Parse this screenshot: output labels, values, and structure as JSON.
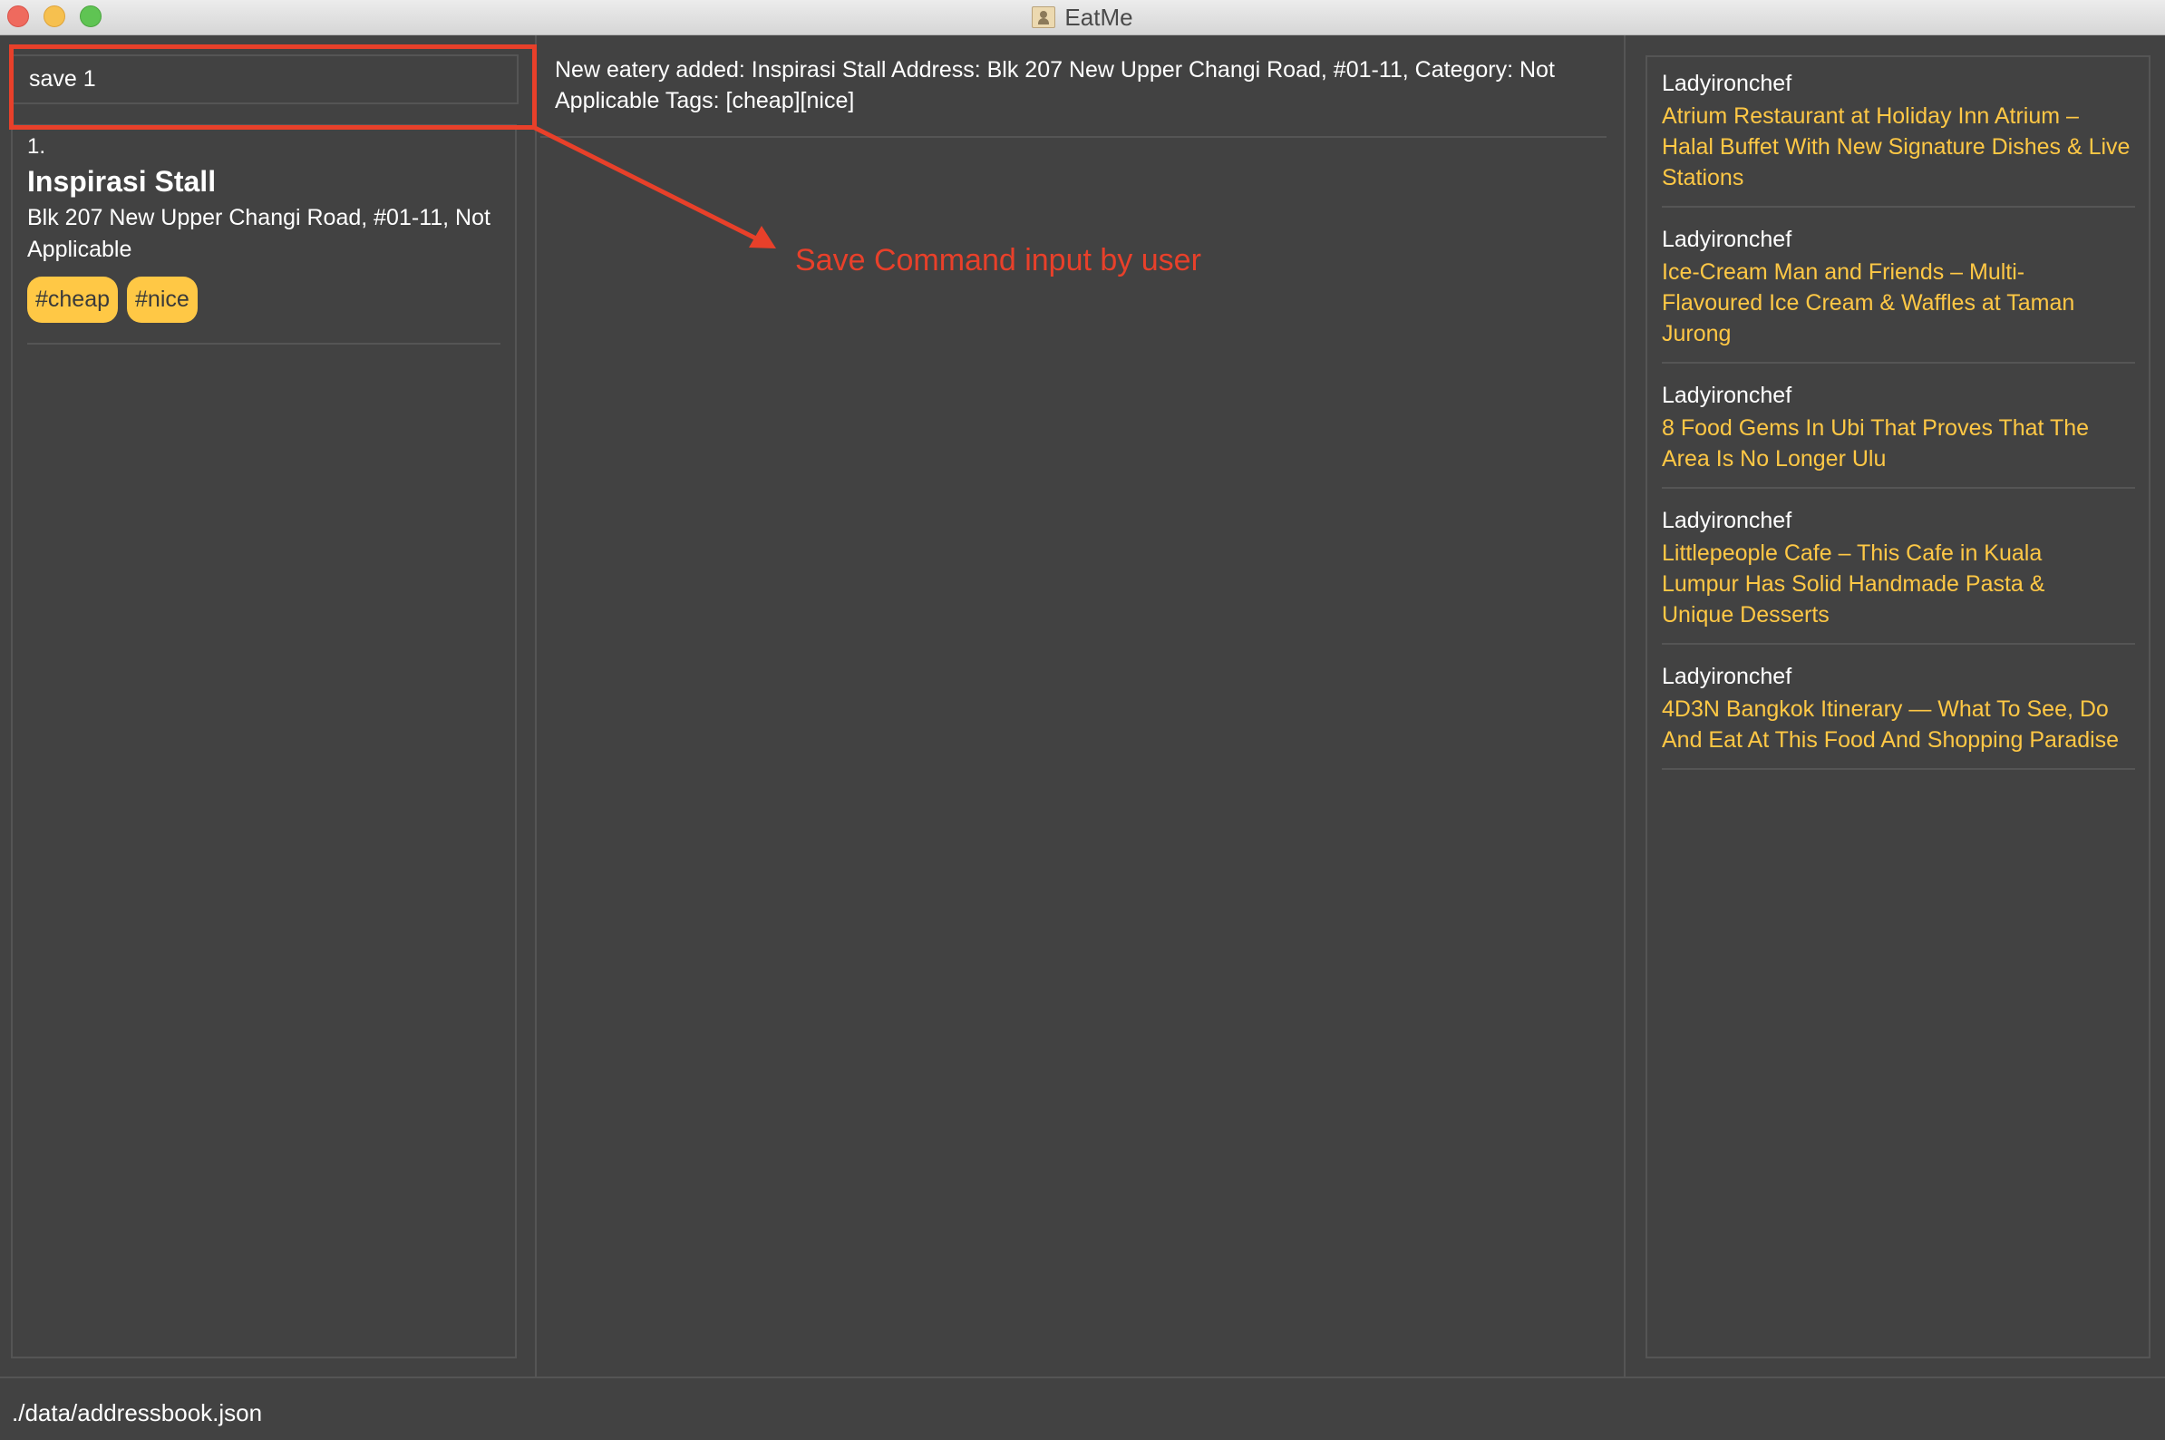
{
  "window": {
    "title": "EatMe",
    "app_icon": "address-book-icon",
    "controls": [
      "close",
      "minimize",
      "maximize"
    ]
  },
  "command_box": {
    "value": "save 1",
    "placeholder": ""
  },
  "result_display": {
    "text": "New eatery added: Inspirasi Stall Address: Blk 207 New Upper Changi Road, #01-11, Category: Not Applicable Tags: [cheap][nice]"
  },
  "eatery_list": {
    "items": [
      {
        "index": "1.",
        "name": "Inspirasi Stall",
        "address": "Blk 207 New Upper Changi Road, #01-11, Not Applicable",
        "tags": [
          "#cheap",
          "#nice"
        ]
      }
    ]
  },
  "feed": {
    "items": [
      {
        "source": "Ladyironchef",
        "title": "Atrium Restaurant at Holiday Inn Atrium – Halal Buffet With New Signature Dishes & Live Stations"
      },
      {
        "source": "Ladyironchef",
        "title": "Ice-Cream Man and Friends – Multi-Flavoured Ice Cream & Waffles at Taman Jurong"
      },
      {
        "source": "Ladyironchef",
        "title": "8 Food Gems In Ubi That Proves That The Area Is No Longer Ulu"
      },
      {
        "source": "Ladyironchef",
        "title": "Littlepeople Cafe – This Cafe in Kuala Lumpur Has Solid Handmade Pasta & Unique Desserts"
      },
      {
        "source": "Ladyironchef",
        "title": "4D3N Bangkok Itinerary — What To See, Do And Eat At This Food And Shopping Paradise"
      }
    ]
  },
  "annotation": {
    "text": "Save Command input by user",
    "color": "#e8402a"
  },
  "status_bar": {
    "path": "./data/addressbook.json"
  },
  "colors": {
    "background": "#424242",
    "tag": "#ffc845",
    "link": "#ffc845",
    "border": "#555555"
  }
}
